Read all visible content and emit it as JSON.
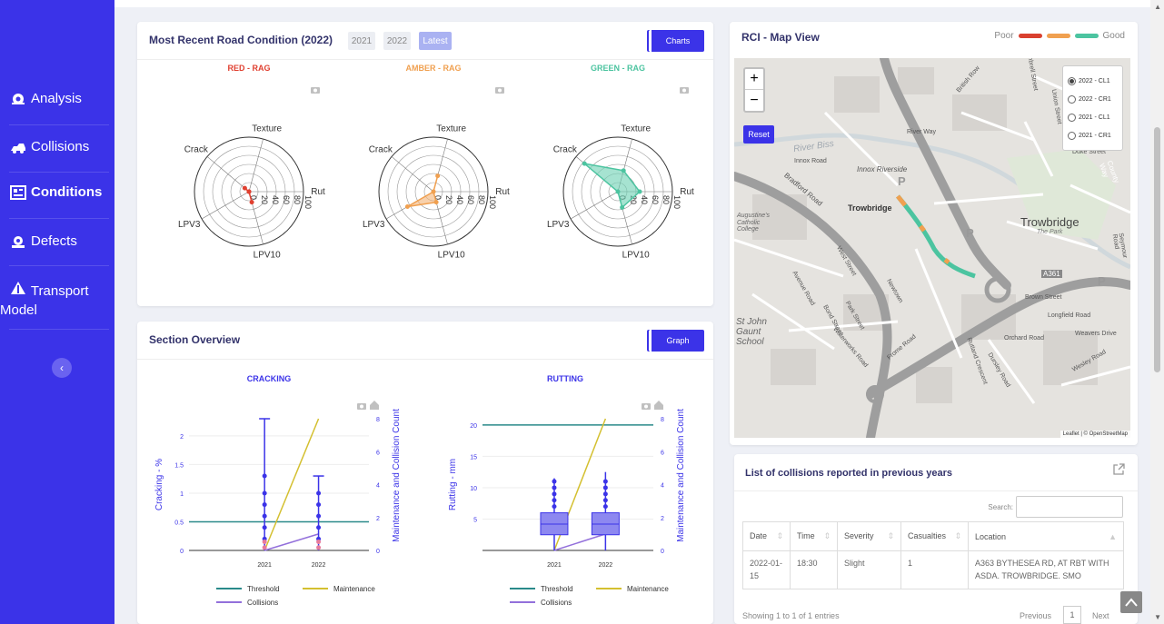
{
  "sidebar": {
    "items": [
      {
        "label": "Analysis",
        "icon": "analysis-icon"
      },
      {
        "label": "Collisions",
        "icon": "collisions-icon"
      },
      {
        "label": "Conditions",
        "icon": "conditions-icon",
        "active": true
      },
      {
        "label": "Defects",
        "icon": "defects-icon"
      },
      {
        "label": "Transport",
        "label2": "Model",
        "icon": "transport-icon"
      }
    ],
    "collapse_glyph": "‹"
  },
  "road_condition": {
    "title": "Most Recent Road Condition (2022)",
    "years": [
      "2021",
      "2022",
      "Latest"
    ],
    "charts_button": "Charts",
    "rag": [
      {
        "title": "RED - RAG",
        "color": "#e04030",
        "fill": "#e04030",
        "values": {
          "Texture": 0,
          "Rut": 0,
          "LPV10": 20,
          "LPV3": 0,
          "Crack": 10
        }
      },
      {
        "title": "AMBER - RAG",
        "color": "#f0a050",
        "fill": "#f4b374",
        "values": {
          "Texture": 30,
          "Rut": 0,
          "LPV10": 20,
          "LPV3": 55,
          "Crack": 0
        }
      },
      {
        "title": "GREEN - RAG",
        "color": "#4cc4a0",
        "fill": "#6bd0b3",
        "values": {
          "Texture": 40,
          "Rut": 40,
          "LPV10": 30,
          "LPV3": 0,
          "Crack": 80
        }
      }
    ],
    "axis_labels": [
      "Texture",
      "Rut",
      "LPV10",
      "LPV3",
      "Crack"
    ],
    "radial_ticks": [
      "0",
      "20",
      "40",
      "60",
      "80",
      "100"
    ]
  },
  "section_overview": {
    "title": "Section Overview",
    "graph_button": "Graph",
    "charts": [
      {
        "title": "CRACKING",
        "ylabel": "Cracking - %",
        "y2label": "Maintenance and Collision Count",
        "yticks": [
          "0",
          "0.5",
          "1",
          "1.5",
          "2"
        ],
        "y2ticks": [
          "0",
          "2",
          "4",
          "6",
          "8"
        ],
        "xticks": [
          "2021",
          "2022"
        ]
      },
      {
        "title": "RUTTING",
        "ylabel": "Rutting - mm",
        "y2label": "Maintenance and Collision Count",
        "yticks": [
          "5",
          "10",
          "15",
          "20"
        ],
        "y2ticks": [
          "0",
          "2",
          "4",
          "6",
          "8"
        ],
        "xticks": [
          "2021",
          "2022"
        ]
      }
    ],
    "legend": [
      "Threshold",
      "Maintenance",
      "Collisions"
    ]
  },
  "chart_data": [
    {
      "type": "line",
      "title": "CRACKING",
      "x": [
        "2021",
        "2022"
      ],
      "series": [
        {
          "name": "Threshold",
          "values": [
            0.5,
            0.5
          ],
          "color": "#2a8a8a"
        },
        {
          "name": "Maintenance",
          "values": [
            0,
            8
          ],
          "axis": "y2",
          "color": "#d4c030"
        },
        {
          "name": "Collisions",
          "values": [
            0,
            1
          ],
          "axis": "y2",
          "color": "#9370db"
        }
      ],
      "ylim": [
        0,
        2.3
      ],
      "y2lim": [
        0,
        8
      ]
    },
    {
      "type": "line",
      "title": "RUTTING",
      "x": [
        "2021",
        "2022"
      ],
      "series": [
        {
          "name": "Threshold",
          "values": [
            20,
            20
          ],
          "color": "#2a8a8a"
        },
        {
          "name": "Maintenance",
          "values": [
            0,
            8
          ],
          "axis": "y2",
          "color": "#d4c030"
        },
        {
          "name": "Collisions",
          "values": [
            0,
            1
          ],
          "axis": "y2",
          "color": "#9370db"
        }
      ],
      "ylim": [
        0,
        21
      ],
      "y2lim": [
        0,
        8
      ]
    }
  ],
  "map": {
    "title": "RCI - Map View",
    "legend_poor": "Poor",
    "legend_good": "Good",
    "legend_colors": [
      "#d9402f",
      "#f0a050",
      "#4cc4a0"
    ],
    "zoom_in": "+",
    "zoom_out": "−",
    "reset": "Reset",
    "layers": [
      "2022 - CL1",
      "2022 - CR1",
      "2021 - CL1",
      "2021 - CR1"
    ],
    "attribution": "Leaflet | © OpenStreetMap",
    "labels": [
      "River Biss",
      "Innox Road",
      "Innox Riverside",
      "Bradford Road",
      "Trowbridge",
      "Trowbridge",
      "The Park",
      "A361",
      "River Way",
      "Duke Street",
      "County Way",
      "Longfield Road",
      "Orchard Road",
      "Frome Road",
      "Newtown",
      "Park Street",
      "Bond Street",
      "Avenue Road",
      "Wesley Road",
      "Brown Street",
      "Union Street",
      "Timbrell Street",
      "British Row",
      "Seymour Road",
      "Augustine's Catholic College",
      "St John Gaunt School",
      "West Street",
      "Waterworks Road",
      "Dursley Road",
      "Weavers Drive",
      "Rutland Crescent",
      "P",
      "P",
      "P"
    ]
  },
  "collisions": {
    "title": "List of collisions reported in previous years",
    "search_label": "Search:",
    "columns": [
      "Date",
      "Time",
      "Severity",
      "Casualties",
      "Location"
    ],
    "rows": [
      {
        "date": "2022-01-15",
        "time": "18:30",
        "severity": "Slight",
        "casualties": "1",
        "location": "A363 BYTHESEA RD, AT RBT WITH ASDA. TROWBRIDGE. SMO"
      }
    ],
    "info": "Showing 1 to 1 of 1 entries",
    "prev": "Previous",
    "page": "1",
    "next": "Next"
  }
}
